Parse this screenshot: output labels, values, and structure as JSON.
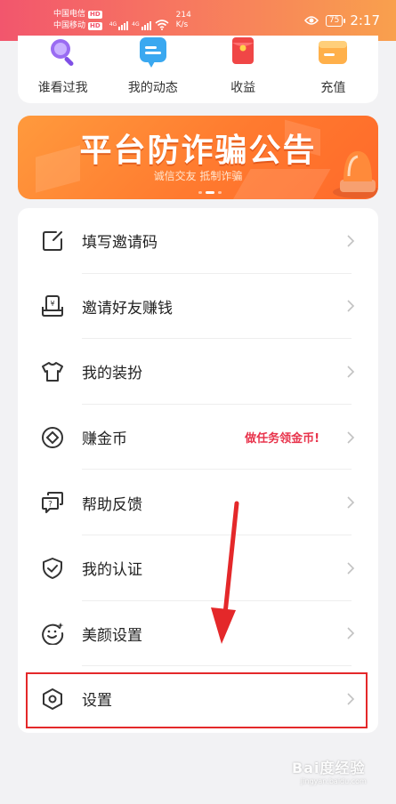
{
  "status_bar": {
    "carrier_1": "中国电信",
    "carrier_2": "中国移动",
    "hd_badge": "HD",
    "network_type": "4G",
    "speed_value": "214",
    "speed_unit": "K/s",
    "battery_level": "75",
    "time": "2:17"
  },
  "quick_menu": {
    "items": [
      {
        "label": "谁看过我",
        "icon": "magnifier-icon"
      },
      {
        "label": "我的动态",
        "icon": "chat-bubble-icon"
      },
      {
        "label": "收益",
        "icon": "red-envelope-icon"
      },
      {
        "label": "充值",
        "icon": "wallet-icon"
      }
    ]
  },
  "banner": {
    "title": "平台防诈骗公告",
    "subtitle": "诚信交友 抵制诈骗",
    "page_count": 3,
    "active_page": 2
  },
  "menu": {
    "items": [
      {
        "label": "填写邀请码",
        "icon": "edit-square-icon",
        "promo": ""
      },
      {
        "label": "邀请好友赚钱",
        "icon": "money-box-icon",
        "promo": ""
      },
      {
        "label": "我的装扮",
        "icon": "tshirt-icon",
        "promo": ""
      },
      {
        "label": "赚金币",
        "icon": "coin-icon",
        "promo": "做任务领金币!"
      },
      {
        "label": "帮助反馈",
        "icon": "help-chat-icon",
        "promo": ""
      },
      {
        "label": "我的认证",
        "icon": "shield-check-icon",
        "promo": ""
      },
      {
        "label": "美颜设置",
        "icon": "beauty-face-icon",
        "promo": ""
      },
      {
        "label": "设置",
        "icon": "hexagon-settings-icon",
        "promo": ""
      }
    ]
  },
  "watermark": {
    "text": "Bai度经验",
    "url": "jingyan.baidu.com"
  },
  "colors": {
    "accent_gradient_start": "#f2566d",
    "accent_gradient_end": "#f9a04d",
    "promo_red": "#e8344c",
    "annotation_red": "#e4282a",
    "banner_orange": "#ff7a2f"
  }
}
